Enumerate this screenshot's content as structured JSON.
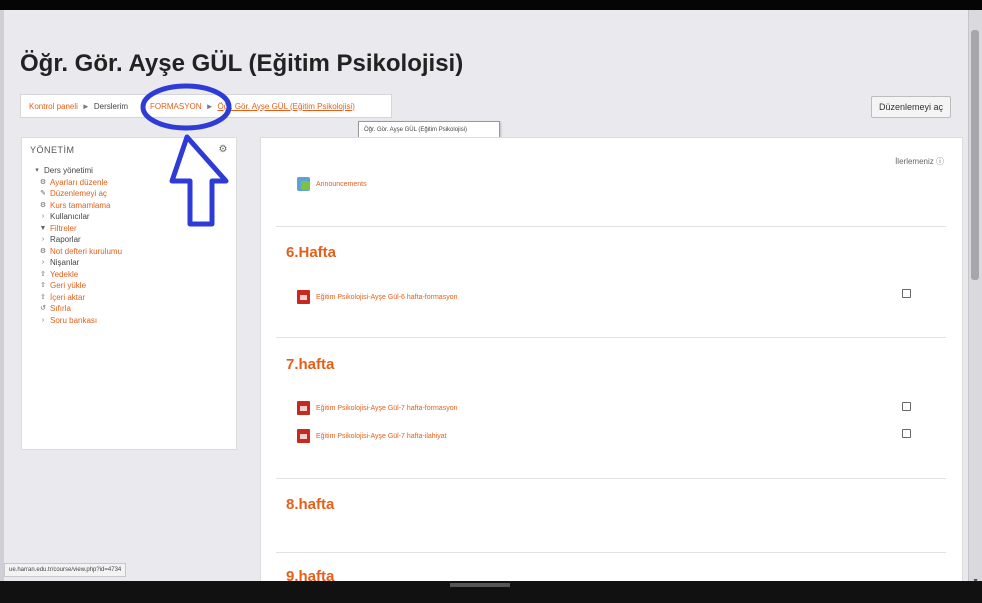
{
  "page": {
    "title": "Öğr. Gör. Ayşe GÜL (Eğitim Psikolojisi)",
    "edit_button": "Düzenlemeyi aç",
    "tooltip": "Öğr. Gör. Ayşe GÜL (Eğitim Psikolojisi)",
    "status_url": "ue.harran.edu.tr/course/view.php?id=4734"
  },
  "breadcrumb": {
    "items": [
      "Kontrol paneli",
      "Derslerim",
      "FORMASYON",
      "Öğr. Gör. Ayşe GÜL (Eğitim Psikolojisi)"
    ],
    "separator": "►"
  },
  "sidebar": {
    "heading": "YÖNETİM",
    "items": [
      {
        "label": "Ders yönetimi",
        "icon": "caret-down-icon"
      },
      {
        "label": "Ayarları düzenle",
        "icon": "gear-icon"
      },
      {
        "label": "Düzenlemeyi aç",
        "icon": "pencil-icon"
      },
      {
        "label": "Kurs tamamlama",
        "icon": "gear-icon"
      },
      {
        "label": "Kullanıcılar",
        "icon": "caret-right-icon"
      },
      {
        "label": "Filtreler",
        "icon": "filter-icon"
      },
      {
        "label": "Raporlar",
        "icon": "caret-right-icon"
      },
      {
        "label": "Not defteri kurulumu",
        "icon": "gear-icon"
      },
      {
        "label": "Nişanlar",
        "icon": "caret-right-icon"
      },
      {
        "label": "Yedekle",
        "icon": "upload-icon"
      },
      {
        "label": "Geri yükle",
        "icon": "upload-icon"
      },
      {
        "label": "İçeri aktar",
        "icon": "upload-icon"
      },
      {
        "label": "Sıfırla",
        "icon": "reset-icon"
      },
      {
        "label": "Soru bankası",
        "icon": "caret-right-icon"
      }
    ]
  },
  "main": {
    "progress_label": "İlerlemeniz",
    "announcements": "Announcements",
    "sections": [
      {
        "title": "6.Hafta",
        "activities": [
          "Eğitim Psikolojisi-Ayşe Gül-6 hafta-formasyon"
        ]
      },
      {
        "title": "7.hafta",
        "activities": [
          "Eğitim Psikolojisi-Ayşe Gül-7 hafta-formasyon",
          "Eğitim Psikolojisi-Ayşe Gül-7 hafta-ilahiyat"
        ]
      },
      {
        "title": "8.hafta",
        "activities": []
      },
      {
        "title": "9.hafta",
        "activities": []
      }
    ]
  },
  "colors": {
    "accent": "#e4601a",
    "annotation": "#2e3bd6"
  }
}
